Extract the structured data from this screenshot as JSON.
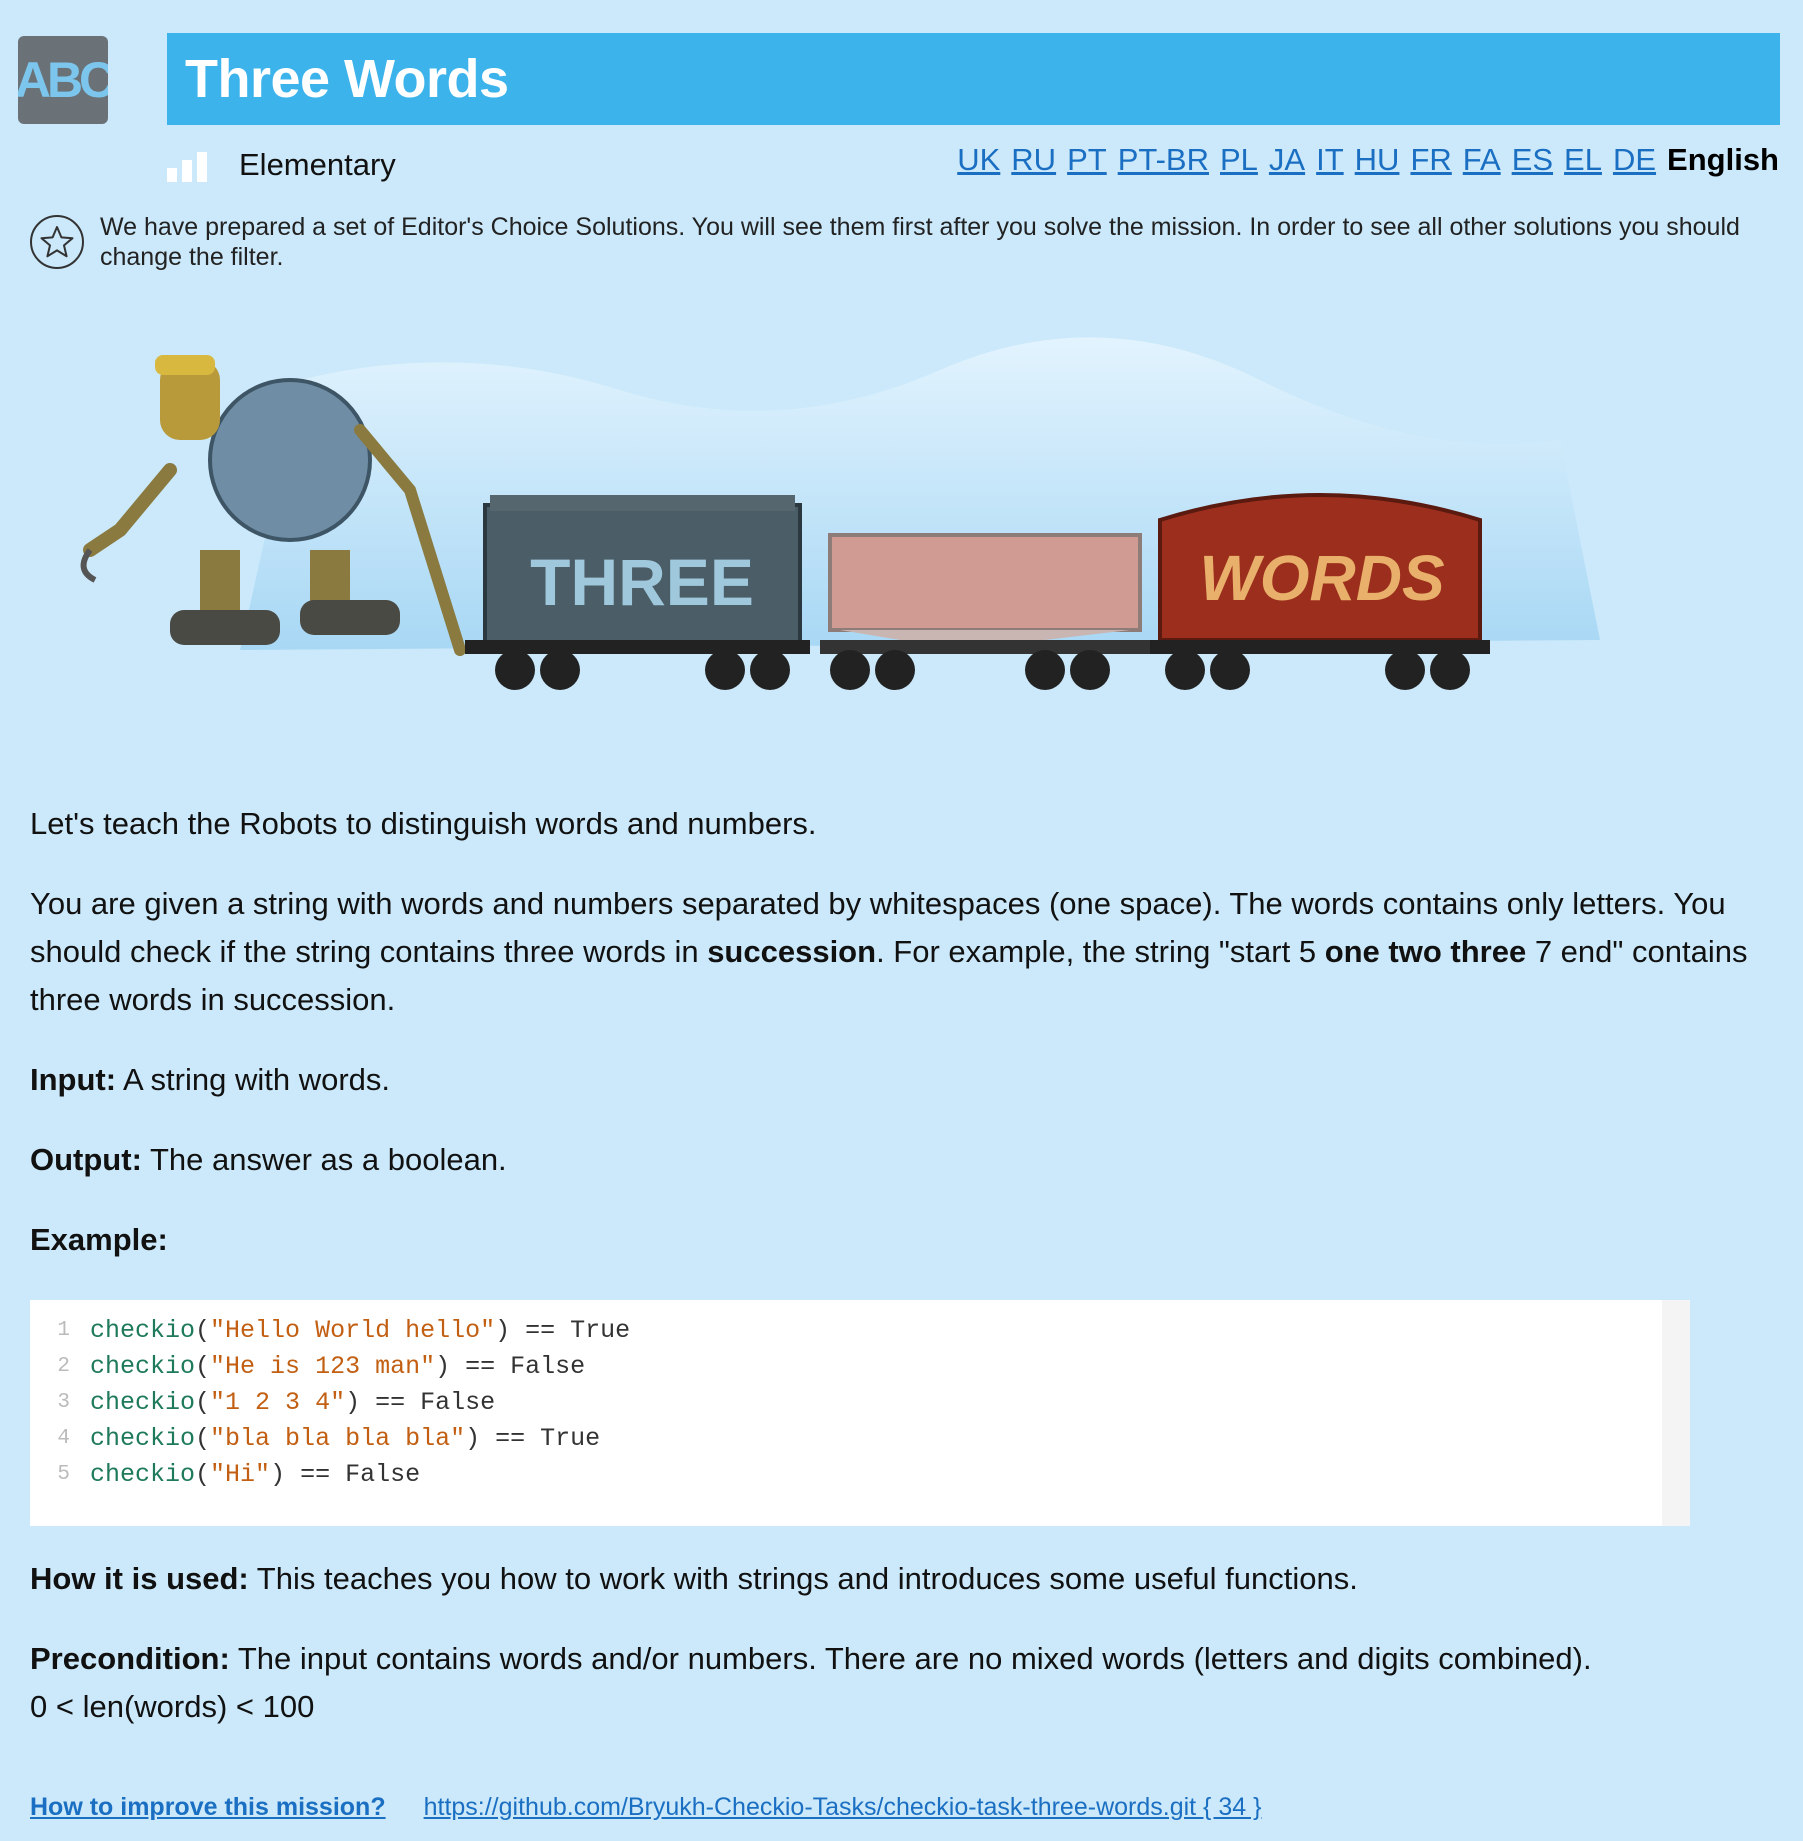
{
  "logo": {
    "text": "ABC"
  },
  "title": "Three Words",
  "level": "Elementary",
  "languages": [
    "UK",
    "RU",
    "PT",
    "PT-BR",
    "PL",
    "JA",
    "IT",
    "HU",
    "FR",
    "FA",
    "ES",
    "EL",
    "DE"
  ],
  "current_language": "English",
  "notice": "We have prepared a set of Editor's Choice Solutions. You will see them first after you solve the mission. In order to see all other solutions you should change the filter.",
  "illustration": {
    "wagon1_text": "THREE",
    "wagon3_text": "WORDS"
  },
  "intro": "Let's teach the Robots to distinguish words and numbers.",
  "description": {
    "part1": "You are given a string with words and numbers separated by whitespaces (one space). The words contains only letters. You should check if the string contains three words in ",
    "bold1": "succession",
    "part2": ". For example, the string \"start 5 ",
    "bold2": "one two three",
    "part3": " 7 end\" contains three words in succession."
  },
  "input": {
    "label": "Input:",
    "text": " A string with words."
  },
  "output": {
    "label": "Output:",
    "text": " The answer as a boolean."
  },
  "example_label": "Example:",
  "code_lines": [
    {
      "num": "1",
      "fn": "checkio",
      "open": "(",
      "arg": "\"Hello World hello\"",
      "rest": ") == True"
    },
    {
      "num": "2",
      "fn": "checkio",
      "open": "(",
      "arg": "\"He is 123 man\"",
      "rest": ") == False"
    },
    {
      "num": "3",
      "fn": "checkio",
      "open": "(",
      "arg": "\"1 2 3 4\"",
      "rest": ") == False"
    },
    {
      "num": "4",
      "fn": "checkio",
      "open": "(",
      "arg": "\"bla bla bla bla\"",
      "rest": ") == True"
    },
    {
      "num": "5",
      "fn": "checkio",
      "open": "(",
      "arg": "\"Hi\"",
      "rest": ") == False"
    }
  ],
  "how_used": {
    "label": "How it is used:",
    "text": " This teaches you how to work with strings and introduces some useful functions."
  },
  "precondition": {
    "label": "Precondition:",
    "text": " The input contains words and/or numbers. There are no mixed words (letters and digits combined).",
    "line2": "0 < len(words) < 100"
  },
  "footer": {
    "help_link": "How to improve this mission?",
    "repo_link": "https://github.com/Bryukh-Checkio-Tasks/checkio-task-three-words.git { 34 }"
  }
}
